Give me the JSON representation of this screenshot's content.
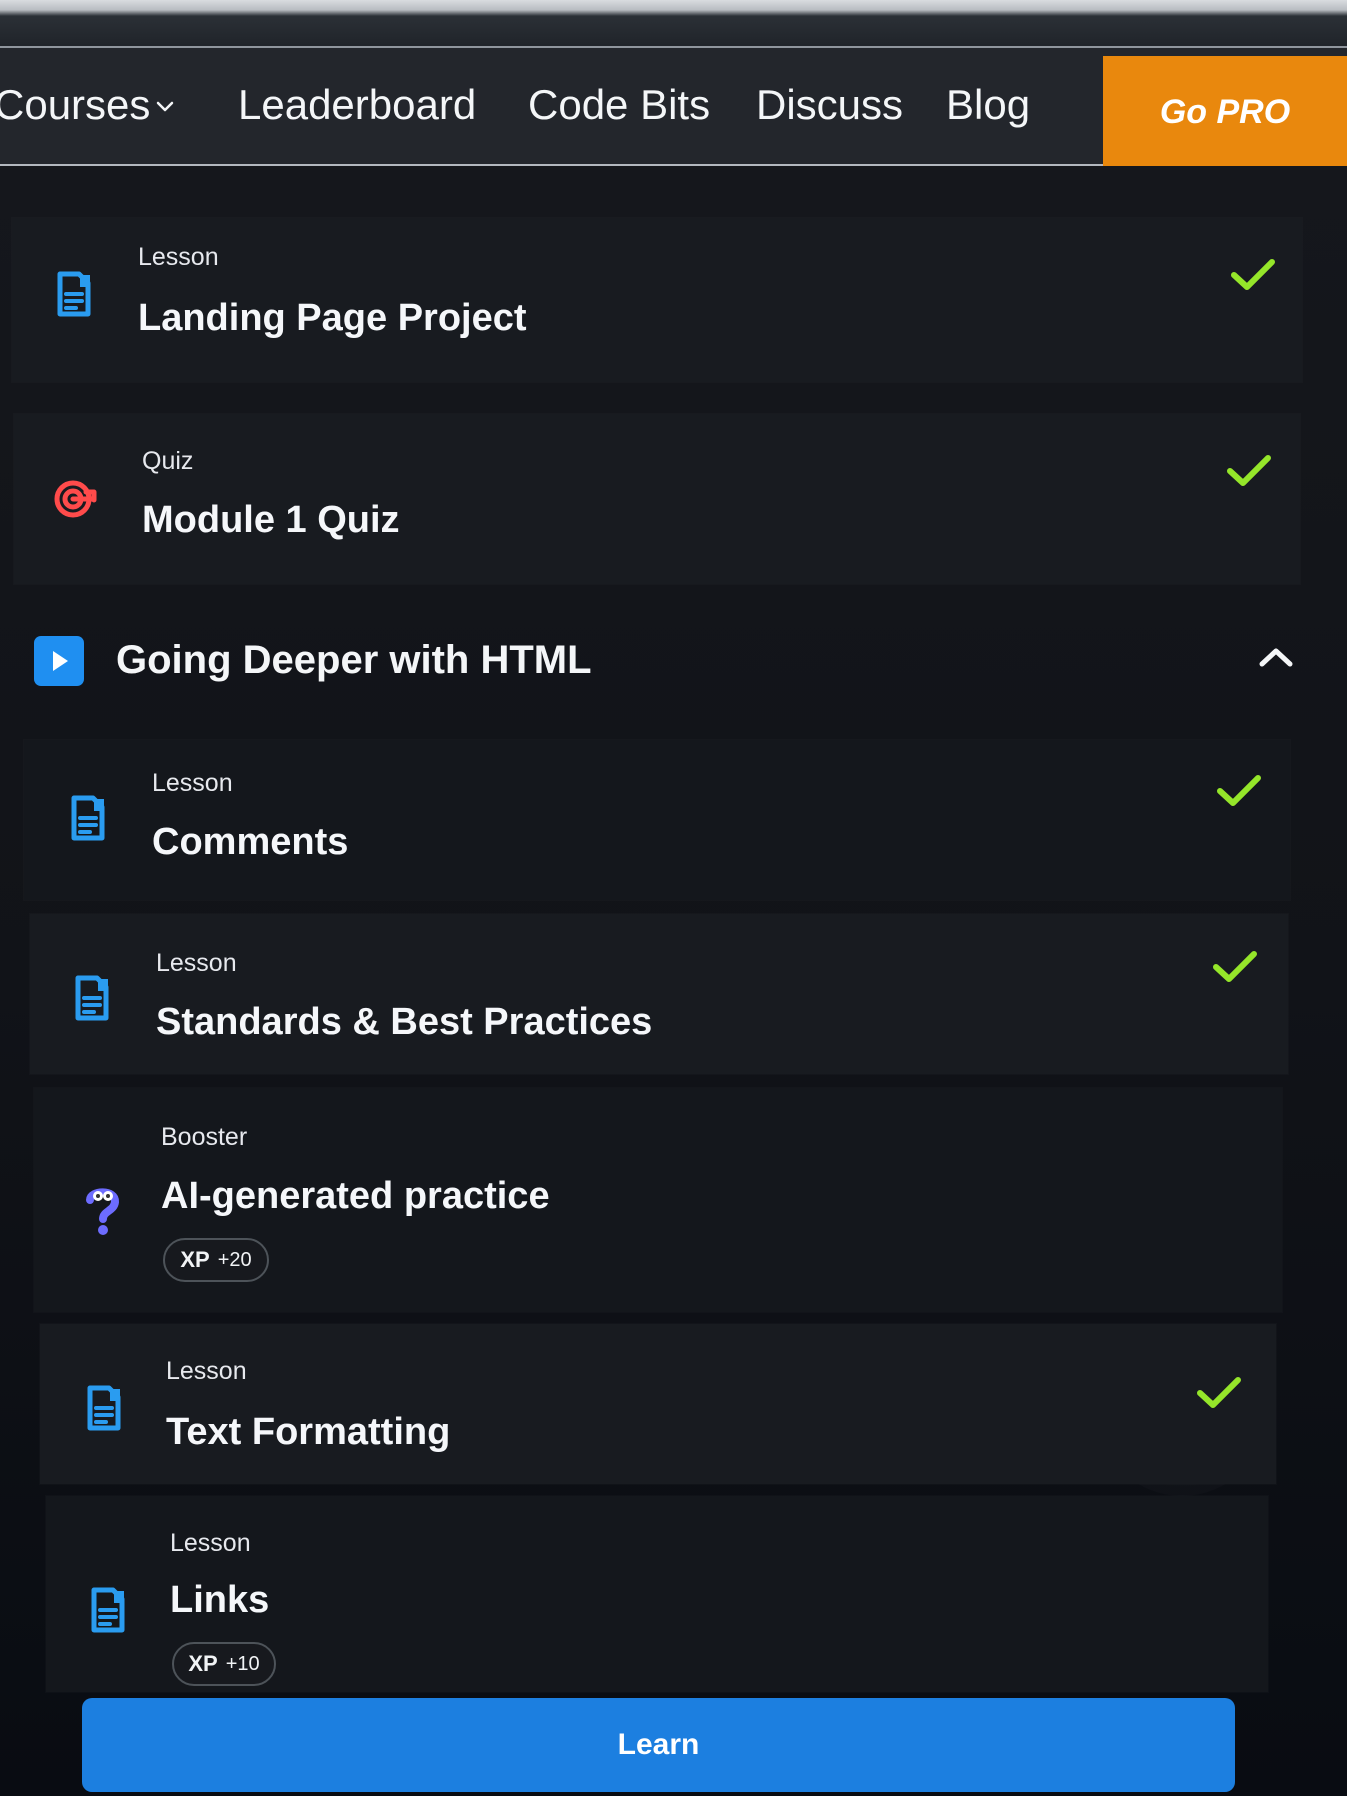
{
  "navbar": {
    "courses_label": "Courses",
    "leaderboard_label": "Leaderboard",
    "codebits_label": "Code Bits",
    "discuss_label": "Discuss",
    "blog_label": "Blog",
    "gopro_label": "Go PRO"
  },
  "items": [
    {
      "type": "Lesson",
      "title": "Landing Page Project",
      "icon": "lesson-icon",
      "completed": true
    },
    {
      "type": "Quiz",
      "title": "Module 1 Quiz",
      "icon": "quiz-target-icon",
      "completed": true
    }
  ],
  "section": {
    "title": "Going Deeper with HTML",
    "icon": "play-icon",
    "expanded_icon": "chevron-up-icon"
  },
  "section_items": [
    {
      "type": "Lesson",
      "title": "Comments",
      "icon": "lesson-icon",
      "completed": true
    },
    {
      "type": "Lesson",
      "title": "Standards & Best Practices",
      "icon": "lesson-icon",
      "completed": true
    },
    {
      "type": "Booster",
      "title": "AI-generated practice",
      "icon": "question-booster-icon",
      "xp_label": "XP",
      "xp_value": "+20",
      "completed": false
    },
    {
      "type": "Lesson",
      "title": "Text Formatting",
      "icon": "lesson-icon",
      "completed": true
    },
    {
      "type": "Lesson",
      "title": "Links",
      "icon": "lesson-icon",
      "xp_label": "XP",
      "xp_value": "+10",
      "completed": false
    }
  ],
  "learn_button": {
    "label": "Learn"
  },
  "colors": {
    "accent_orange": "#e9880d",
    "accent_blue": "#1f8ff1",
    "check_green": "#95e62a",
    "quiz_red": "#ff4b4b",
    "booster_purple": "#6d6cff"
  }
}
